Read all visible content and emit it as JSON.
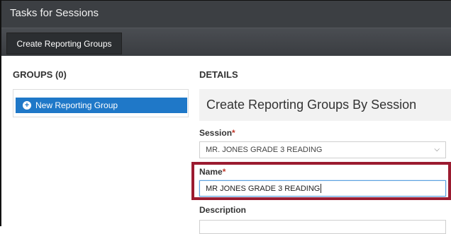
{
  "window": {
    "title": "Tasks for Sessions"
  },
  "toolbar": {
    "tab_label": "Create Reporting Groups"
  },
  "groups": {
    "heading": "GROUPS (0)",
    "new_button_label": "New Reporting Group"
  },
  "details": {
    "heading": "DETAILS",
    "panel_title": "Create Reporting Groups By Session",
    "session": {
      "label": "Session",
      "required_mark": "*",
      "value": "MR. JONES GRADE 3 READING"
    },
    "name": {
      "label": "Name",
      "required_mark": "*",
      "value": "MR JONES GRADE 3 READING"
    },
    "description": {
      "label": "Description",
      "value": ""
    }
  },
  "colors": {
    "titlebar": "#3c3f43",
    "accent_blue": "#1f78c8",
    "highlight_border": "#9b1b30",
    "required": "#c0392b"
  },
  "icons": {
    "new_group": "plus-circle-icon",
    "session_dropdown": "chevron-down-icon"
  }
}
